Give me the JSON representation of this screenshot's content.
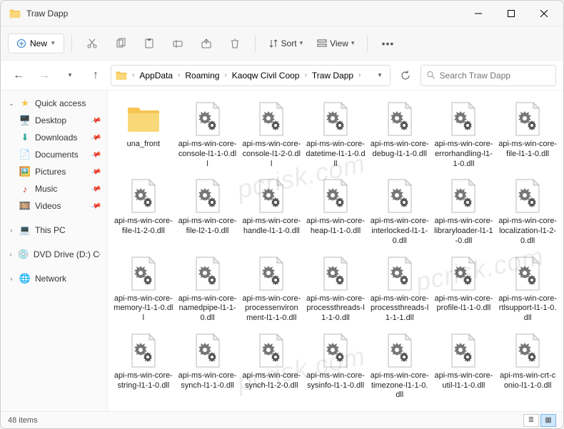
{
  "window": {
    "title": "Traw Dapp"
  },
  "toolbar": {
    "new_label": "New",
    "sort_label": "Sort",
    "view_label": "View"
  },
  "breadcrumb": {
    "items": [
      "AppData",
      "Roaming",
      "Kaoqw Civil Coop",
      "Traw Dapp"
    ]
  },
  "search": {
    "placeholder": "Search Traw Dapp"
  },
  "sidebar": {
    "quick_access": "Quick access",
    "items": [
      {
        "label": "Desktop",
        "icon": "desktop",
        "pinned": true
      },
      {
        "label": "Downloads",
        "icon": "downloads",
        "pinned": true
      },
      {
        "label": "Documents",
        "icon": "documents",
        "pinned": true
      },
      {
        "label": "Pictures",
        "icon": "pictures",
        "pinned": true
      },
      {
        "label": "Music",
        "icon": "music",
        "pinned": true
      },
      {
        "label": "Videos",
        "icon": "videos",
        "pinned": true
      }
    ],
    "this_pc": "This PC",
    "dvd": "DVD Drive (D:) CCCC",
    "network": "Network"
  },
  "files": [
    {
      "type": "folder",
      "name": "una_front"
    },
    {
      "type": "dll",
      "name": "api-ms-win-core-console-l1-1-0.dll"
    },
    {
      "type": "dll",
      "name": "api-ms-win-core-console-l1-2-0.dll"
    },
    {
      "type": "dll",
      "name": "api-ms-win-core-datetime-l1-1-0.dll"
    },
    {
      "type": "dll",
      "name": "api-ms-win-core-debug-l1-1-0.dll"
    },
    {
      "type": "dll",
      "name": "api-ms-win-core-errorhandling-l1-1-0.dll"
    },
    {
      "type": "dll",
      "name": "api-ms-win-core-file-l1-1-0.dll"
    },
    {
      "type": "dll",
      "name": "api-ms-win-core-file-l1-2-0.dll"
    },
    {
      "type": "dll",
      "name": "api-ms-win-core-file-l2-1-0.dll"
    },
    {
      "type": "dll",
      "name": "api-ms-win-core-handle-l1-1-0.dll"
    },
    {
      "type": "dll",
      "name": "api-ms-win-core-heap-l1-1-0.dll"
    },
    {
      "type": "dll",
      "name": "api-ms-win-core-interlocked-l1-1-0.dll"
    },
    {
      "type": "dll",
      "name": "api-ms-win-core-libraryloader-l1-1-0.dll"
    },
    {
      "type": "dll",
      "name": "api-ms-win-core-localization-l1-2-0.dll"
    },
    {
      "type": "dll",
      "name": "api-ms-win-core-memory-l1-1-0.dll"
    },
    {
      "type": "dll",
      "name": "api-ms-win-core-namedpipe-l1-1-0.dll"
    },
    {
      "type": "dll",
      "name": "api-ms-win-core-processenvironment-l1-1-0.dll"
    },
    {
      "type": "dll",
      "name": "api-ms-win-core-processthreads-l1-1-0.dll"
    },
    {
      "type": "dll",
      "name": "api-ms-win-core-processthreads-l1-1-1.dll"
    },
    {
      "type": "dll",
      "name": "api-ms-win-core-profile-l1-1-0.dll"
    },
    {
      "type": "dll",
      "name": "api-ms-win-core-rtlsupport-l1-1-0.dll"
    },
    {
      "type": "dll",
      "name": "api-ms-win-core-string-l1-1-0.dll"
    },
    {
      "type": "dll",
      "name": "api-ms-win-core-synch-l1-1-0.dll"
    },
    {
      "type": "dll",
      "name": "api-ms-win-core-synch-l1-2-0.dll"
    },
    {
      "type": "dll",
      "name": "api-ms-win-core-sysinfo-l1-1-0.dll"
    },
    {
      "type": "dll",
      "name": "api-ms-win-core-timezone-l1-1-0.dll"
    },
    {
      "type": "dll",
      "name": "api-ms-win-core-util-l1-1-0.dll"
    },
    {
      "type": "dll",
      "name": "api-ms-win-crt-conio-l1-1-0.dll"
    }
  ],
  "status": {
    "count_label": "48 items"
  },
  "watermark": "pcrisk.com"
}
